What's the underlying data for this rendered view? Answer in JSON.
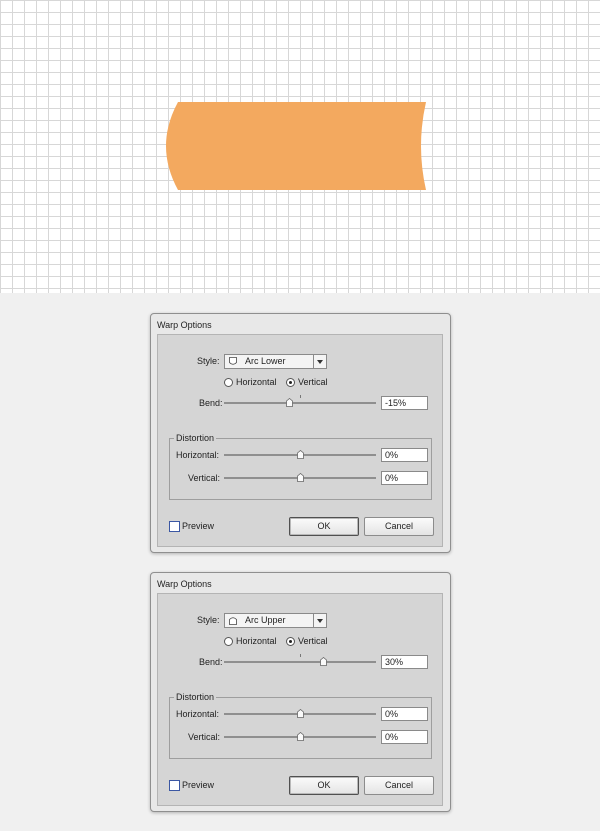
{
  "canvas": {
    "shape_color": "#f3a95f",
    "grid_color": "#d7d7d7"
  },
  "dialogs": [
    {
      "title": "Warp Options",
      "style_label": "Style:",
      "style_value": "Arc Lower",
      "style_icon": "arc-lower-icon",
      "orientation": {
        "horizontal_label": "Horizontal",
        "vertical_label": "Vertical",
        "selected": "Vertical"
      },
      "bend_label": "Bend:",
      "bend_value": "-15%",
      "bend_percent": -15,
      "distortion": {
        "group_label": "Distortion",
        "horizontal_label": "Horizontal:",
        "horizontal_value": "0%",
        "horizontal_percent": 0,
        "vertical_label": "Vertical:",
        "vertical_value": "0%",
        "vertical_percent": 0
      },
      "preview_label": "Preview",
      "preview_checked": false,
      "ok_label": "OK",
      "cancel_label": "Cancel"
    },
    {
      "title": "Warp Options",
      "style_label": "Style:",
      "style_value": "Arc Upper",
      "style_icon": "arc-upper-icon",
      "orientation": {
        "horizontal_label": "Horizontal",
        "vertical_label": "Vertical",
        "selected": "Vertical"
      },
      "bend_label": "Bend:",
      "bend_value": "30%",
      "bend_percent": 30,
      "distortion": {
        "group_label": "Distortion",
        "horizontal_label": "Horizontal:",
        "horizontal_value": "0%",
        "horizontal_percent": 0,
        "vertical_label": "Vertical:",
        "vertical_value": "0%",
        "vertical_percent": 0
      },
      "preview_label": "Preview",
      "preview_checked": false,
      "ok_label": "OK",
      "cancel_label": "Cancel"
    }
  ]
}
